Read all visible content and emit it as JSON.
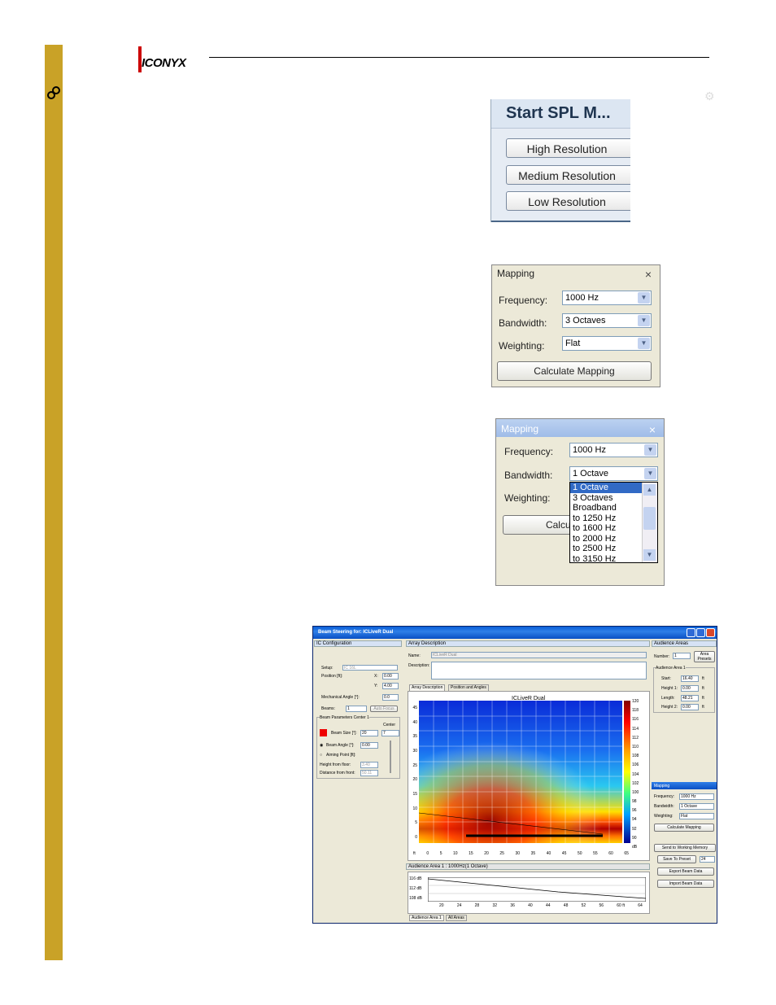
{
  "header": {
    "logo_text": "ICONYX"
  },
  "spl": {
    "title": "Start SPL M...",
    "buttons": [
      "High Resolution",
      "Medium Resolution",
      "Low Resolution"
    ]
  },
  "mapping1": {
    "title": "Mapping",
    "frequency_label": "Frequency:",
    "frequency_value": "1000 Hz",
    "bandwidth_label": "Bandwidth:",
    "bandwidth_value": "3 Octaves",
    "weighting_label": "Weighting:",
    "weighting_value": "Flat",
    "calc_button": "Calculate Mapping"
  },
  "mapping2": {
    "title": "Mapping",
    "frequency_label": "Frequency:",
    "frequency_value": "1000 Hz",
    "bandwidth_label": "Bandwidth:",
    "bandwidth_value": "1 Octave",
    "weighting_label": "Weighting:",
    "calc_button_partial": "Calcula",
    "options": [
      "1 Octave",
      "3 Octaves",
      "Broadband",
      "to 1250 Hz",
      "to 1600 Hz",
      "to 2000 Hz",
      "to 2500 Hz",
      "to 3150 Hz"
    ]
  },
  "beam": {
    "title": "Beam Steering for: ICLiveR Dual",
    "ic_config": "IC Configuration",
    "setup_label": "Setup:",
    "setup_value": "IC 16L",
    "position_label": "Position [ft]:",
    "x_label": "X:",
    "x_value": "0.00",
    "y_label": "Y:",
    "y_value": "4.00",
    "mech_angle_label": "Mechanical Angle [°]:",
    "mech_angle_value": "0.0",
    "beams_label": "Beams:",
    "beams_value": "1",
    "auto_focus": "Auto Focus",
    "beam_params": "Beam Parameters Center 1",
    "beam_size_label": "Beam Size [°]:",
    "beam_size_value": "20",
    "center_label": "Center",
    "center_value": "7",
    "beam_angle_label": "Beam Angle [°]:",
    "beam_angle_value": "0.00",
    "aiming_point_label": "Aiming Point [ft]:",
    "height_floor_label": "Height from floor:",
    "height_floor_value": "3.40",
    "distance_front_label": "Distance from front:",
    "distance_front_value": "50.11",
    "array_desc": "Array Description",
    "name_label": "Name:",
    "name_value": "ICLiveR Dual",
    "description_label": "Description:",
    "tab_array": "Array Description",
    "tab_position": "Position and Angles",
    "plot_title": "ICLiveR Dual",
    "y_ticks": [
      "45",
      "40",
      "35",
      "30",
      "25",
      "20",
      "15",
      "10",
      "5",
      "0"
    ],
    "x_ticks": [
      "ft",
      "0",
      "5",
      "10",
      "15",
      "20",
      "25",
      "30",
      "35",
      "40",
      "45",
      "50",
      "55",
      "60",
      "65"
    ],
    "db_ticks": [
      "120",
      "118",
      "116",
      "114",
      "112",
      "110",
      "108",
      "106",
      "104",
      "102",
      "100",
      "98",
      "96",
      "94",
      "92",
      "90",
      "dB"
    ],
    "audience_bar": "Audience Area 1 : 1000Hz(1 Octave)",
    "line_y_ticks": [
      "116 dB",
      "112 dB",
      "108 dB"
    ],
    "line_x_ticks": [
      "20",
      "24",
      "28",
      "32",
      "36",
      "40",
      "44",
      "48",
      "52",
      "56",
      "60 ft",
      "64"
    ],
    "tab_aud1": "Audience Area 1",
    "tab_all": "All Areas",
    "audience_areas": "Audience Areas",
    "number_label": "Number:",
    "number_value": "1",
    "area_presets": "Area Presets",
    "aud_area1": "Audience Area 1",
    "start_label": "Start:",
    "start_value": "16.40",
    "height1_label": "Height 1:",
    "height1_value": "0.00",
    "length_label": "Length:",
    "length_value": "48.21",
    "height2_label": "Height 2:",
    "height2_value": "0.00",
    "unit_ft": "ft",
    "mapping": "Mapping",
    "freq_label": "Frequency:",
    "freq_value": "1000 Hz",
    "bw_label": "Bandwidth:",
    "bw_value": "1 Octave",
    "wt_label": "Weighting:",
    "wt_value": "Flat",
    "calc_mapping": "Calculate Mapping",
    "send_memory": "Send to Working Memory",
    "save_preset": "Save To Preset",
    "preset_value": "24",
    "export": "Export Beam Data",
    "import": "Import Beam Data"
  }
}
